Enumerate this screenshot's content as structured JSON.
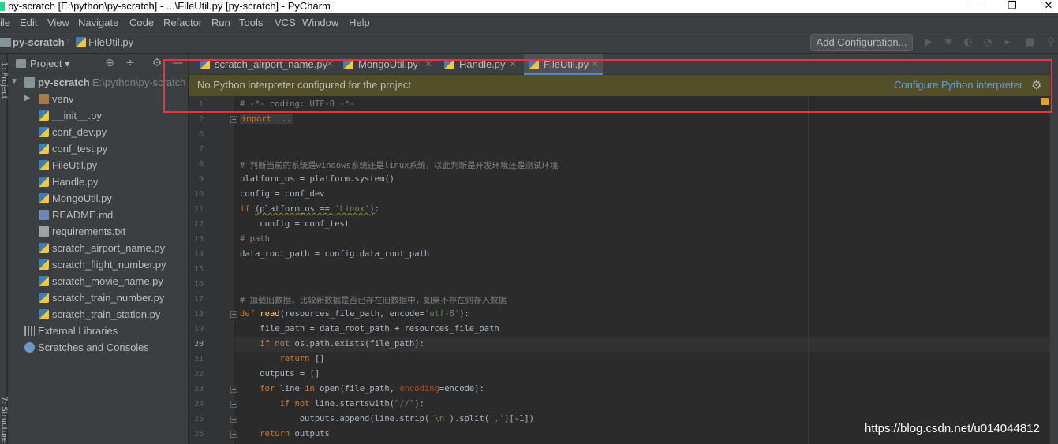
{
  "window": {
    "title": "py-scratch [E:\\python\\py-scratch] - ...\\FileUtil.py [py-scratch] - PyCharm",
    "controls": [
      "—",
      "❐",
      "✕"
    ]
  },
  "menu": [
    "ile",
    "Edit",
    "View",
    "Navigate",
    "Code",
    "Refactor",
    "Run",
    "Tools",
    "VCS",
    "Window",
    "Help"
  ],
  "navbar": {
    "project": "py-scratch",
    "file": "FileUtil.py",
    "add_configuration": "Add Configuration..."
  },
  "left_stripe": {
    "project_label": "1: Project",
    "structure_label": "7: Structure"
  },
  "project_panel": {
    "title": "Project",
    "root": {
      "name": "py-scratch",
      "path": "E:\\python\\py-scratch"
    },
    "items": [
      {
        "name": "venv",
        "type": "folder"
      },
      {
        "name": "__init__.py",
        "type": "py"
      },
      {
        "name": "conf_dev.py",
        "type": "py"
      },
      {
        "name": "conf_test.py",
        "type": "py"
      },
      {
        "name": "FileUtil.py",
        "type": "py"
      },
      {
        "name": "Handle.py",
        "type": "py"
      },
      {
        "name": "MongoUtil.py",
        "type": "py"
      },
      {
        "name": "README.md",
        "type": "md"
      },
      {
        "name": "requirements.txt",
        "type": "txt"
      },
      {
        "name": "scratch_airport_name.py",
        "type": "py"
      },
      {
        "name": "scratch_flight_number.py",
        "type": "py"
      },
      {
        "name": "scratch_movie_name.py",
        "type": "py"
      },
      {
        "name": "scratch_train_number.py",
        "type": "py"
      },
      {
        "name": "scratch_train_station.py",
        "type": "py"
      }
    ],
    "external_libraries": "External Libraries",
    "scratches": "Scratches and Consoles"
  },
  "tabs": [
    {
      "label": "scratch_airport_name.py",
      "active": false
    },
    {
      "label": "MongoUtil.py",
      "active": false
    },
    {
      "label": "Handle.py",
      "active": false
    },
    {
      "label": "FileUtil.py",
      "active": true
    }
  ],
  "banner": {
    "message": "No Python interpreter configured for the project",
    "action": "Configure Python interpreter"
  },
  "editor": {
    "line_numbers": [
      "1",
      "2",
      "6",
      "7",
      "8",
      "9",
      "10",
      "11",
      "12",
      "13",
      "14",
      "15",
      "16",
      "17",
      "18",
      "19",
      "20",
      "21",
      "22",
      "23",
      "24",
      "25",
      "26"
    ],
    "current_line": "20"
  },
  "watermark": "https://blog.csdn.net/u014044812",
  "colors": {
    "accent": "#4a88c7",
    "banner_bg": "#524e27",
    "annotation": "#e8343c",
    "link": "#589df6"
  }
}
